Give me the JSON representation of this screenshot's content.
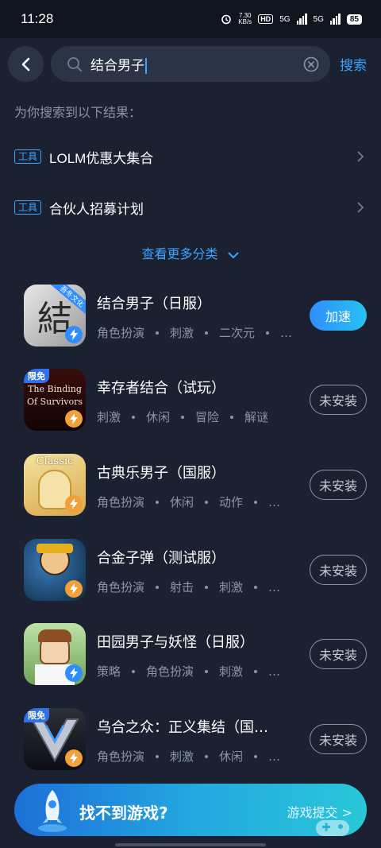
{
  "status_bar": {
    "time": "11:28",
    "net_speed": "7.30\nKB/s",
    "hd": "HD",
    "net1": "5G",
    "net2": "5G",
    "battery": "85"
  },
  "search": {
    "query": "结合男子",
    "submit_label": "搜索"
  },
  "results_hint": "为你搜索到以下结果：",
  "categories": [
    {
      "tag": "工具",
      "title": "LOLM优惠大集合"
    },
    {
      "tag": "工具",
      "title": "合伙人招募计划"
    }
  ],
  "more_categories_label": "查看更多分类",
  "games": [
    {
      "name": "结合男子（日服）",
      "tags": [
        "角色扮演",
        "刺激",
        "二次元",
        "…"
      ],
      "button": "加速",
      "button_type": "accelerate",
      "corner_badge": "",
      "icon_text": "結",
      "icon_ribbon": "吾冬文化",
      "bolt_color": "#2f8eff"
    },
    {
      "name": "幸存者结合（试玩）",
      "tags": [
        "刺激",
        "休闲",
        "冒险",
        "解谜"
      ],
      "button": "未安装",
      "button_type": "uninstalled",
      "corner_badge": "限免",
      "icon_text": "The Binding Of Survivors",
      "bolt_color": "#f2a03a"
    },
    {
      "name": "古典乐男子（国服）",
      "tags": [
        "角色扮演",
        "休闲",
        "动作",
        "…"
      ],
      "button": "未安装",
      "button_type": "uninstalled",
      "corner_badge": "",
      "icon_text": "Classic",
      "bolt_color": "#f2a03a"
    },
    {
      "name": "合金子弹（测试服）",
      "tags": [
        "角色扮演",
        "射击",
        "刺激",
        "…"
      ],
      "button": "未安装",
      "button_type": "uninstalled",
      "corner_badge": "",
      "icon_text": "",
      "bolt_color": "#f2a03a"
    },
    {
      "name": "田园男子与妖怪（日服）",
      "tags": [
        "策略",
        "角色扮演",
        "刺激",
        "…"
      ],
      "button": "未安装",
      "button_type": "uninstalled",
      "corner_badge": "",
      "icon_text": "",
      "bolt_color": "#2f8eff"
    },
    {
      "name": "乌合之众：正义集结（国…",
      "tags": [
        "角色扮演",
        "刺激",
        "休闲",
        "…"
      ],
      "button": "未安装",
      "button_type": "uninstalled",
      "corner_badge": "限免",
      "icon_text": "",
      "bolt_color": "#f2a03a"
    }
  ],
  "banner": {
    "title": "找不到游戏?",
    "link": "游戏提交 >"
  },
  "colors": {
    "accent": "#3aa4ff",
    "background": "#1b2130",
    "tag_text": "#8994a8"
  }
}
